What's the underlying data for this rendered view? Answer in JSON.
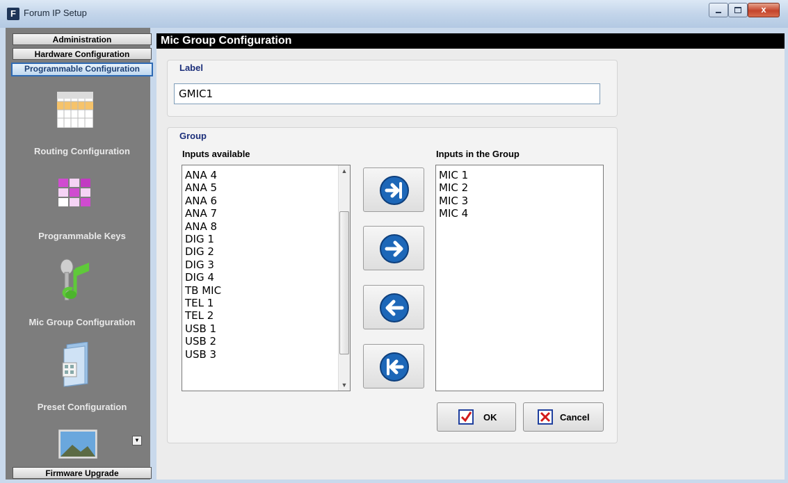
{
  "window": {
    "app_icon_letter": "F",
    "title": "Forum IP Setup",
    "controls": {
      "close_glyph": "x"
    }
  },
  "sidebar": {
    "top_buttons": [
      "Administration",
      "Hardware Configuration",
      "Programmable Configuration"
    ],
    "items": [
      {
        "label": "Routing Configuration",
        "icon": "grid-table-icon"
      },
      {
        "label": "Programmable Keys",
        "icon": "keypad-icon"
      },
      {
        "label": "Mic Group Configuration",
        "icon": "microphone-music-icon"
      },
      {
        "label": "Preset Configuration",
        "icon": "folder-document-icon"
      }
    ],
    "bottom_button": "Firmware Upgrade"
  },
  "main": {
    "header": "Mic Group Configuration",
    "label_section": {
      "title": "Label",
      "value": "GMIC1"
    },
    "group_section": {
      "title": "Group",
      "available_title": "Inputs available",
      "available_items": [
        "ANA 4",
        "ANA 5",
        "ANA 6",
        "ANA 7",
        "ANA 8",
        "DIG 1",
        "DIG 2",
        "DIG 3",
        "DIG 4",
        "TB MIC",
        "TEL 1",
        "TEL 2",
        "USB 1",
        "USB 2",
        "USB 3"
      ],
      "group_title": "Inputs in the Group",
      "group_items": [
        "MIC 1",
        "MIC 2",
        "MIC 3",
        "MIC 4"
      ]
    },
    "buttons": {
      "ok": "OK",
      "cancel": "Cancel"
    }
  },
  "colors": {
    "accent": "#1f3f9e",
    "header_bg": "#000000",
    "sidebar_bg": "#7d7d7d"
  }
}
